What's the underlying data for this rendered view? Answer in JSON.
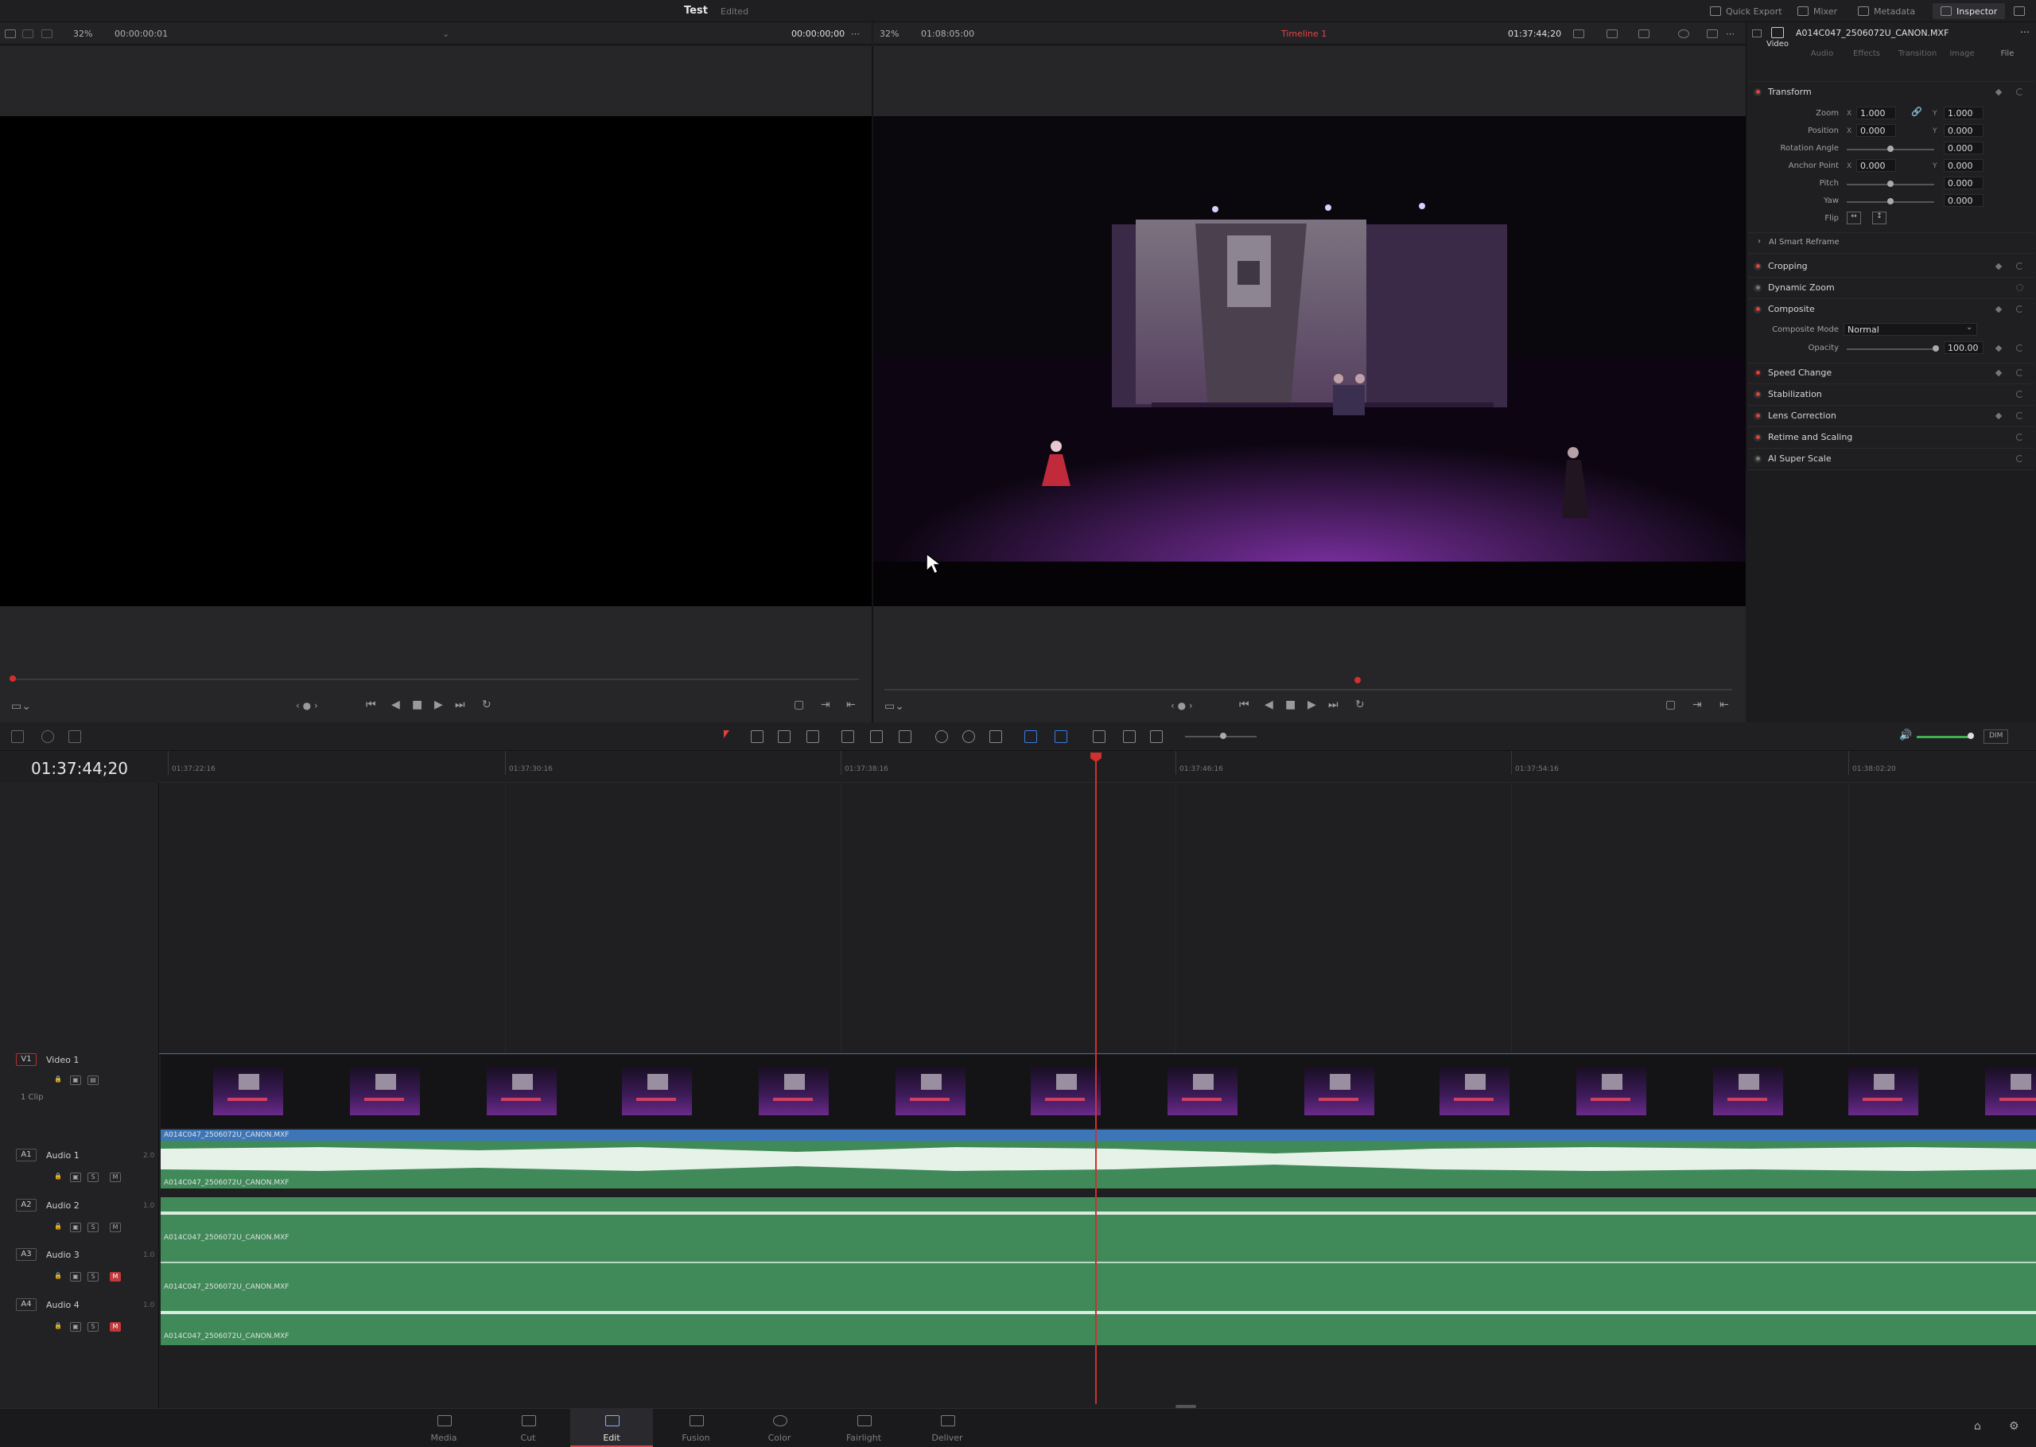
{
  "app": {
    "title": "Test",
    "status": "Edited"
  },
  "top_right": {
    "quick_export": "Quick Export",
    "mixer": "Mixer",
    "metadata": "Metadata",
    "inspector": "Inspector"
  },
  "source": {
    "zoom": "32%",
    "timecode_left": "00:00:00:01",
    "timecode_right": "00:00:00;00"
  },
  "timeline_viewer": {
    "zoom": "32%",
    "timecode_left": "01:08:05:00",
    "timeline_name": "Timeline 1",
    "timecode_right": "01:37:44;20"
  },
  "inspector": {
    "clip_name": "A014C047_2506072U_CANON.MXF",
    "tabs": [
      {
        "label": "Video"
      },
      {
        "label": "Audio"
      },
      {
        "label": "Effects"
      },
      {
        "label": "Transition"
      },
      {
        "label": "Image"
      },
      {
        "label": "File"
      }
    ],
    "transform": {
      "title": "Transform",
      "zoom_label": "Zoom",
      "zoom_x": "1.000",
      "zoom_y": "1.000",
      "position_label": "Position",
      "pos_x": "0.000",
      "pos_y": "0.000",
      "rotation_label": "Rotation Angle",
      "rotation": "0.000",
      "anchor_label": "Anchor Point",
      "anchor_x": "0.000",
      "anchor_y": "0.000",
      "pitch_label": "Pitch",
      "pitch": "0.000",
      "yaw_label": "Yaw",
      "yaw": "0.000",
      "flip_label": "Flip",
      "x": "X",
      "y": "Y"
    },
    "ai_smart_reframe": "AI Smart Reframe",
    "cropping": "Cropping",
    "dynamic_zoom": "Dynamic Zoom",
    "composite": {
      "title": "Composite",
      "mode_label": "Composite Mode",
      "mode_value": "Normal",
      "opacity_label": "Opacity",
      "opacity_value": "100.00",
      "opacity_level": 1.0
    },
    "speed_change": "Speed Change",
    "stabilization": "Stabilization",
    "lens_correction": "Lens Correction",
    "retime": "Retime and Scaling",
    "super_scale": "AI Super Scale"
  },
  "timeline": {
    "current_tc": "01:37:44;20",
    "dim_label": "DIM",
    "ruler": [
      "01:37:22:16",
      "01:37:30:16",
      "01:37:38:16",
      "01:37:46:16",
      "01:37:54:16",
      "01:38:02:20"
    ],
    "tracks": {
      "v1": {
        "tag": "V1",
        "name": "Video 1",
        "clips": "1 Clip"
      },
      "a1": {
        "tag": "A1",
        "name": "Audio 1",
        "ch": "2.0",
        "s": "S",
        "m": "M"
      },
      "a2": {
        "tag": "A2",
        "name": "Audio 2",
        "ch": "1.0",
        "s": "S",
        "m": "M"
      },
      "a3": {
        "tag": "A3",
        "name": "Audio 3",
        "ch": "1.0",
        "s": "S",
        "m": "M"
      },
      "a4": {
        "tag": "A4",
        "name": "Audio 4",
        "ch": "1.0",
        "s": "S",
        "m": "M"
      }
    },
    "clip_name": "A014C047_2506072U_CANON.MXF"
  },
  "pages": [
    {
      "label": "Media"
    },
    {
      "label": "Cut"
    },
    {
      "label": "Edit"
    },
    {
      "label": "Fusion"
    },
    {
      "label": "Color"
    },
    {
      "label": "Fairlight"
    },
    {
      "label": "Deliver"
    }
  ]
}
